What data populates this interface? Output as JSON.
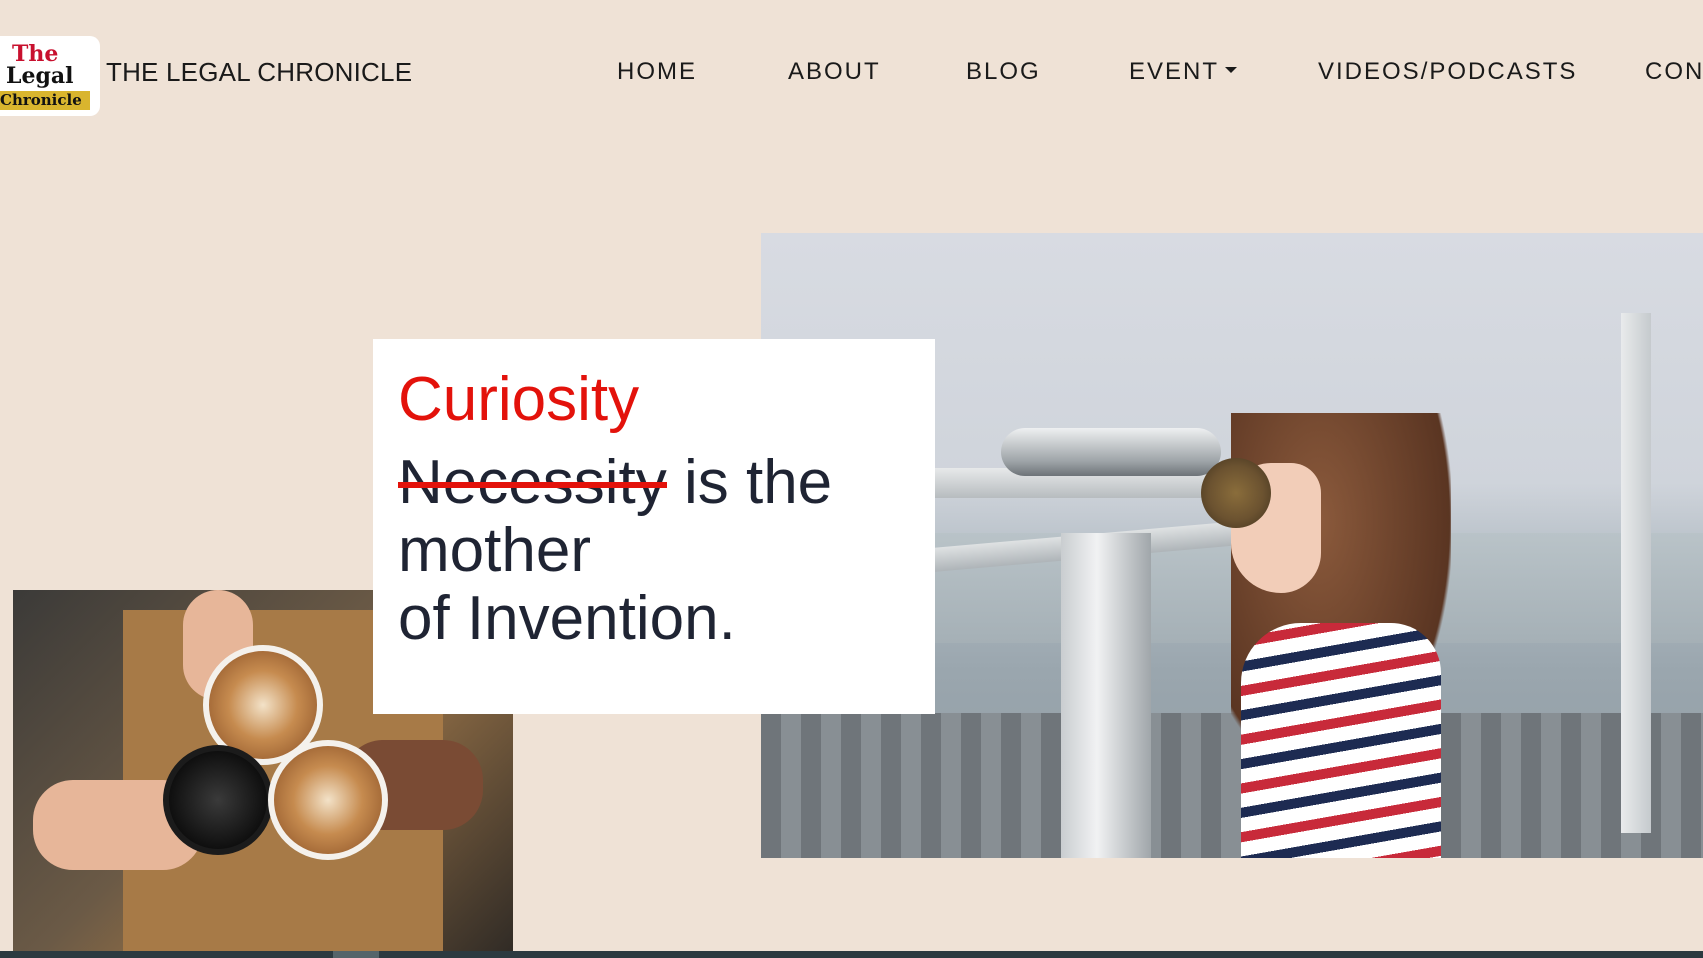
{
  "logo": {
    "line1": "The",
    "line2": "Legal",
    "line3": "Chronicle",
    "accent": "#c8102e",
    "banner": "#d9b52e"
  },
  "site_title": "THE LEGAL CHRONICLE",
  "nav": {
    "items": [
      {
        "label": "HOME"
      },
      {
        "label": "ABOUT"
      },
      {
        "label": "BLOG"
      },
      {
        "label": "EVENT",
        "has_dropdown": true
      },
      {
        "label": "VIDEOS/PODCASTS"
      },
      {
        "label": "CONT"
      }
    ]
  },
  "hero": {
    "quote_highlight": "Curiosity",
    "quote_struck": "Necessity",
    "quote_rest_line1": " is the",
    "quote_line2": "mother",
    "quote_line3": "of Invention."
  },
  "colors": {
    "background": "#efe2d6",
    "accent_red": "#e3120b",
    "text_dark": "#1f2433"
  }
}
